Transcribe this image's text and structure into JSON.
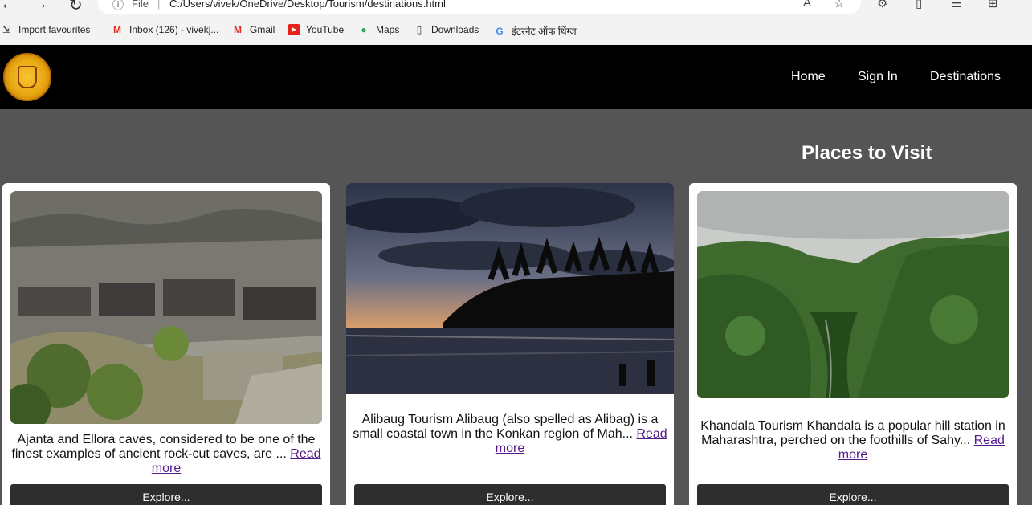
{
  "browser": {
    "url_scheme": "File",
    "url": "C:/Users/vivek/OneDrive/Desktop/Tourism/destinations.html",
    "bookmarks": [
      {
        "label": "Import favourites",
        "icon": "import-icon"
      },
      {
        "label": "Inbox (126) - vivekj...",
        "icon": "gmail-icon"
      },
      {
        "label": "Gmail",
        "icon": "gmail-icon"
      },
      {
        "label": "YouTube",
        "icon": "youtube-icon"
      },
      {
        "label": "Maps",
        "icon": "maps-pin-icon"
      },
      {
        "label": "Downloads",
        "icon": "document-icon"
      },
      {
        "label": "इंटरनेट ऑफ थिंग्ज",
        "icon": "google-icon"
      }
    ]
  },
  "header": {
    "nav": [
      "Home",
      "Sign In",
      "Destinations"
    ]
  },
  "main": {
    "title": "Places to Visit",
    "cards": [
      {
        "text": "Ajanta and Ellora caves, considered to be one of the finest examples of ancient rock-cut caves, are ...",
        "more": "Read more",
        "button": "Explore..."
      },
      {
        "text": "Alibaug Tourism Alibaug (also spelled as Alibag) is a small coastal town in the Konkan region of Mah...",
        "more": "Read more",
        "button": "Explore..."
      },
      {
        "text": "Khandala Tourism Khandala is a popular hill station in Maharashtra, perched on the foothills of Sahy...",
        "more": "Read more",
        "button": "Explore..."
      }
    ]
  },
  "colors": {
    "header_bg": "#000000",
    "page_bg": "#555555",
    "button_bg": "#2e2e2e",
    "link": "#551a8b"
  }
}
